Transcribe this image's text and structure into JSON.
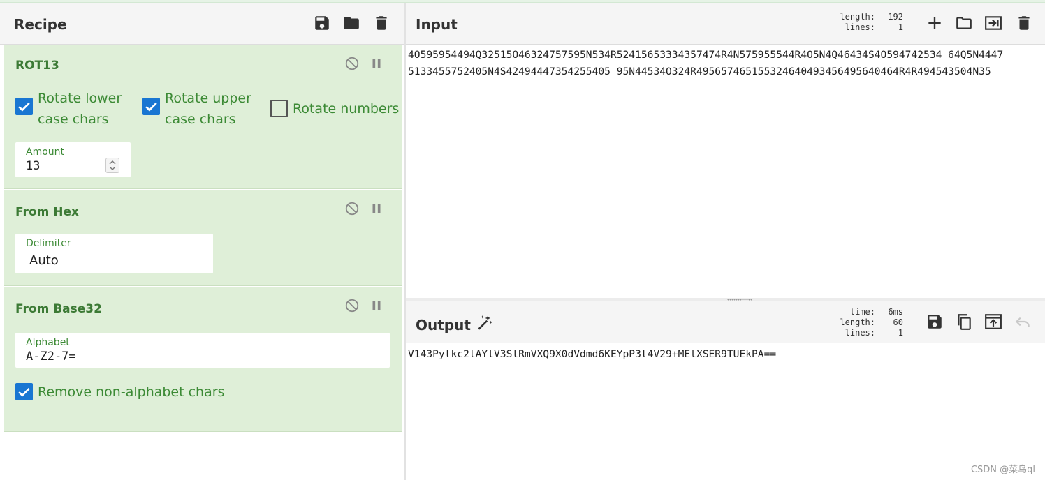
{
  "recipe": {
    "title": "Recipe",
    "icons": [
      "save-icon",
      "folder-icon",
      "trash-icon"
    ]
  },
  "operations": [
    {
      "name": "ROT13",
      "options": [
        {
          "label": "Rotate lower case chars",
          "checked": true
        },
        {
          "label": "Rotate upper case chars",
          "checked": true
        },
        {
          "label": "Rotate numbers",
          "checked": false
        }
      ],
      "amount_label": "Amount",
      "amount_value": "13"
    },
    {
      "name": "From Hex",
      "delimiter_label": "Delimiter",
      "delimiter_value": "Auto"
    },
    {
      "name": "From Base32",
      "alphabet_label": "Alphabet",
      "alphabet_value": "A-Z2-7=",
      "remove_label": "Remove non-alphabet chars",
      "remove_checked": true
    }
  ],
  "input": {
    "title": "Input",
    "stats": {
      "length_label": "length:",
      "length": "192",
      "lines_label": "lines:",
      "lines": "1"
    },
    "line1": "4O595954494Q32515O46324757595N534R52415653334357474R4N575955544R4O5N4Q46434S4O594742534 64Q5N4447",
    "line2": "5133455752405N4S42494447354255405 95N44534O324R495657465155324640493456495640464R4R494543504N35",
    "icons": [
      "plus-icon",
      "folder-icon",
      "input-icon",
      "trash-icon"
    ]
  },
  "output": {
    "title": "Output",
    "stats": {
      "time_label": "time:",
      "time": "6ms",
      "length_label": "length:",
      "length": "60",
      "lines_label": "lines:",
      "lines": "1"
    },
    "text": "V143Pytkc2lAYlV3SlRmVXQ9X0dVdmd6KEYpP3t4V29+MElXSER9TUEkPA==",
    "icons": [
      "save-icon",
      "copy-icon",
      "replace-input-icon",
      "undo-icon"
    ]
  },
  "watermark": "CSDN @菜鸟ql",
  "colors": {
    "op_bg": "#dfefd8",
    "op_text": "#3c7a35",
    "checkbox": "#1976d2",
    "header_bg": "#f5f5f5"
  }
}
